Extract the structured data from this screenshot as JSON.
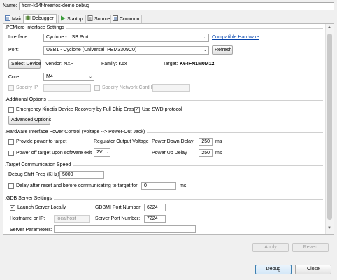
{
  "header": {
    "name_label": "Name:",
    "name_value": "frdm-k64f-freertos-demo debug"
  },
  "tabs": [
    {
      "label": "Main"
    },
    {
      "label": "Debugger"
    },
    {
      "label": "Startup"
    },
    {
      "label": "Source"
    },
    {
      "label": "Common"
    }
  ],
  "pemicro": {
    "title": "PEMicro Interface Settings",
    "interface_label": "Interface:",
    "interface_value": "Cyclone - USB Port",
    "compatible_link": "Compatible Hardware",
    "port_label": "Port:",
    "port_value": "USB1 - Cyclone (Universal_PEM3309C0)",
    "refresh_label": "Refresh",
    "select_device_label": "Select Device",
    "vendor_text": "Vendor: NXP",
    "family_text": "Family: K6x",
    "target_label": "Target:",
    "target_value": "K64FN1M0M12",
    "core_label": "Core:",
    "core_value": "M4",
    "specify_ip_label": "Specify IP",
    "specify_nic_label": "Specify Network Card IP"
  },
  "additional": {
    "title": "Additional Options",
    "emergency_label": "Emergency Kinetis Device Recovery by Full Chip Erase",
    "swd_label": "Use SWD protocol",
    "advanced_label": "Advanced Options"
  },
  "power": {
    "title": "Hardware Interface Power Control (Voltage --> Power-Out Jack)",
    "provide_power_label": "Provide power to target",
    "power_off_label": "Power off target upon software exit",
    "regulator_label": "Regulator Output Voltage",
    "voltage_value": "2V",
    "power_down_label": "Power Down Delay",
    "power_down_value": "250",
    "power_down_unit": "ms",
    "power_up_label": "Power Up Delay",
    "power_up_value": "250",
    "power_up_unit": "ms"
  },
  "comm": {
    "title": "Target Communication Speed",
    "shift_label": "Debug Shift Freq (KHz)",
    "shift_value": "5000",
    "delay_label": "Delay after reset and before communicating to target for",
    "delay_value": "0",
    "delay_unit": "ms"
  },
  "gdb": {
    "title": "GDB Server Settings",
    "launch_label": "Launch Server Locally",
    "gdbmi_label": "GDBMI Port Number:",
    "gdbmi_value": "6224",
    "hostname_label": "Hostname or IP:",
    "hostname_value": "localhost",
    "server_port_label": "Server Port Number:",
    "server_port_value": "7224",
    "server_params_label": "Server Parameters:",
    "server_params_value": ""
  },
  "actions": {
    "apply_label": "Apply",
    "revert_label": "Revert"
  },
  "footer": {
    "debug_label": "Debug",
    "close_label": "Close"
  }
}
